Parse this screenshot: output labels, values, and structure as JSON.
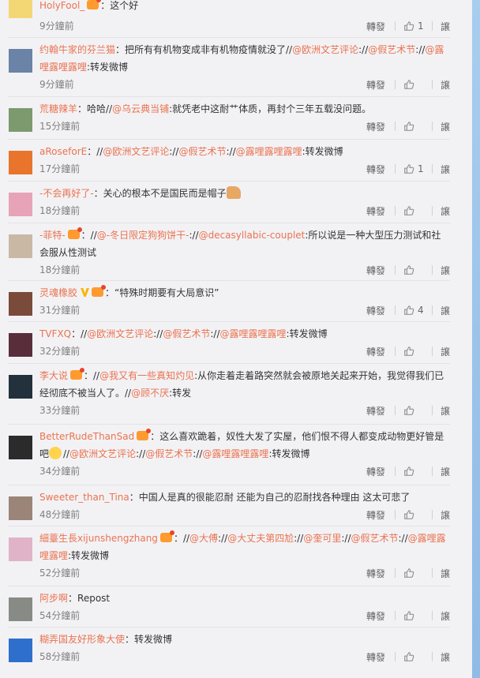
{
  "actions": {
    "repost": "轉發",
    "reply": "譲"
  },
  "comments": [
    {
      "user": "HolyFool_",
      "badge": true,
      "text": [
        {
          "t": "：这个好"
        }
      ],
      "time": "9分鐘前",
      "likes": "1"
    },
    {
      "user": "约翰牛家的芬兰猫",
      "text": [
        {
          "t": "：把所有有机物变成非有机物疫情就没了//"
        },
        {
          "t": "@欧洲文艺评论",
          "at": true
        },
        {
          "t": "://"
        },
        {
          "t": "@假艺术节",
          "at": true
        },
        {
          "t": "://"
        },
        {
          "t": "@露哩露哩露哩",
          "at": true
        },
        {
          "t": ":转发微博"
        }
      ],
      "time": "9分鐘前",
      "likes": ""
    },
    {
      "user": "荒糖辣羊",
      "text": [
        {
          "t": "：哈哈//"
        },
        {
          "t": "@乌云典当铺",
          "at": true
        },
        {
          "t": ":就凭老中这耐艹体质，再封个三年五载没问题。"
        }
      ],
      "time": "15分鐘前",
      "likes": ""
    },
    {
      "user": "aRoseforE",
      "text": [
        {
          "t": "：//"
        },
        {
          "t": "@欧洲文艺评论",
          "at": true
        },
        {
          "t": "://"
        },
        {
          "t": "@假艺术节",
          "at": true
        },
        {
          "t": "://"
        },
        {
          "t": "@露哩露哩露哩",
          "at": true
        },
        {
          "t": ":转发微博"
        }
      ],
      "time": "17分鐘前",
      "likes": "1"
    },
    {
      "user": "-不会再好了-",
      "text": [
        {
          "t": "：关心的根本不是国民而是帽子"
        }
      ],
      "thumbs": true,
      "time": "18分鐘前",
      "likes": ""
    },
    {
      "user": "-菲特-",
      "badge": true,
      "text": [
        {
          "t": "：//"
        },
        {
          "t": "@-冬日限定狗狗饼干-",
          "at": true
        },
        {
          "t": "://"
        },
        {
          "t": "@decasyllabic-couplet",
          "at": true
        },
        {
          "t": ":所以说是一种大型压力测试和社会服从性测试"
        }
      ],
      "time": "18分鐘前",
      "likes": ""
    },
    {
      "user": "灵魂橡胶",
      "vip": true,
      "badge": true,
      "text": [
        {
          "t": "：“特殊时期要有大局意识”"
        }
      ],
      "time": "31分鐘前",
      "likes": "4"
    },
    {
      "user": "TVFXQ",
      "text": [
        {
          "t": "：//"
        },
        {
          "t": "@欧洲文艺评论",
          "at": true
        },
        {
          "t": "://"
        },
        {
          "t": "@假艺术节",
          "at": true
        },
        {
          "t": "://"
        },
        {
          "t": "@露哩露哩露哩",
          "at": true
        },
        {
          "t": ":转发微博"
        }
      ],
      "time": "32分鐘前",
      "likes": ""
    },
    {
      "user": "李大说",
      "badge": true,
      "text": [
        {
          "t": "：//"
        },
        {
          "t": "@我又有一些真知灼见",
          "at": true
        },
        {
          "t": ":从你走着走着路突然就会被原地关起来开始，我觉得我们已经彻底不被当人了。//"
        },
        {
          "t": "@顾不厌",
          "at": true
        },
        {
          "t": ":转发"
        }
      ],
      "time": "33分鐘前",
      "likes": ""
    },
    {
      "user": "BetterRudeThanSad",
      "badge": true,
      "text": [
        {
          "t": "：这么喜欢跪着，奴性大发了实屋，他们恨不得人都变成动物更好管是吧"
        },
        {
          "emoji": true
        },
        {
          "t": "//"
        },
        {
          "t": "@欧洲文艺评论",
          "at": true
        },
        {
          "t": "://"
        },
        {
          "t": "@假艺术节",
          "at": true
        },
        {
          "t": "://"
        },
        {
          "t": "@露哩露哩露哩",
          "at": true
        },
        {
          "t": ":转发微博"
        }
      ],
      "time": "34分鐘前",
      "likes": ""
    },
    {
      "user": "Sweeter_than_Tina",
      "text": [
        {
          "t": "：中国人是真的很能忍耐 还能为自己的忍耐找各种理由 这太可悲了"
        }
      ],
      "time": "48分鐘前",
      "likes": ""
    },
    {
      "user": "細薹生長xijunshengzhang",
      "badge": true,
      "text": [
        {
          "t": "：//"
        },
        {
          "t": "@大傅",
          "at": true
        },
        {
          "t": "://"
        },
        {
          "t": "@大丈夫第四尬",
          "at": true
        },
        {
          "t": "://"
        },
        {
          "t": "@奎可里",
          "at": true
        },
        {
          "t": "://"
        },
        {
          "t": "@假艺术节",
          "at": true
        },
        {
          "t": "://"
        },
        {
          "t": "@露哩露哩露哩",
          "at": true
        },
        {
          "t": ":转发微博"
        }
      ],
      "time": "52分鐘前",
      "likes": ""
    },
    {
      "user": "阿步啊",
      "text": [
        {
          "t": "：Repost"
        }
      ],
      "time": "54分鐘前",
      "likes": ""
    },
    {
      "user": "糊弄国友好形象大使",
      "text": [
        {
          "t": "：转发微博"
        }
      ],
      "time": "58分鐘前",
      "likes": ""
    }
  ]
}
